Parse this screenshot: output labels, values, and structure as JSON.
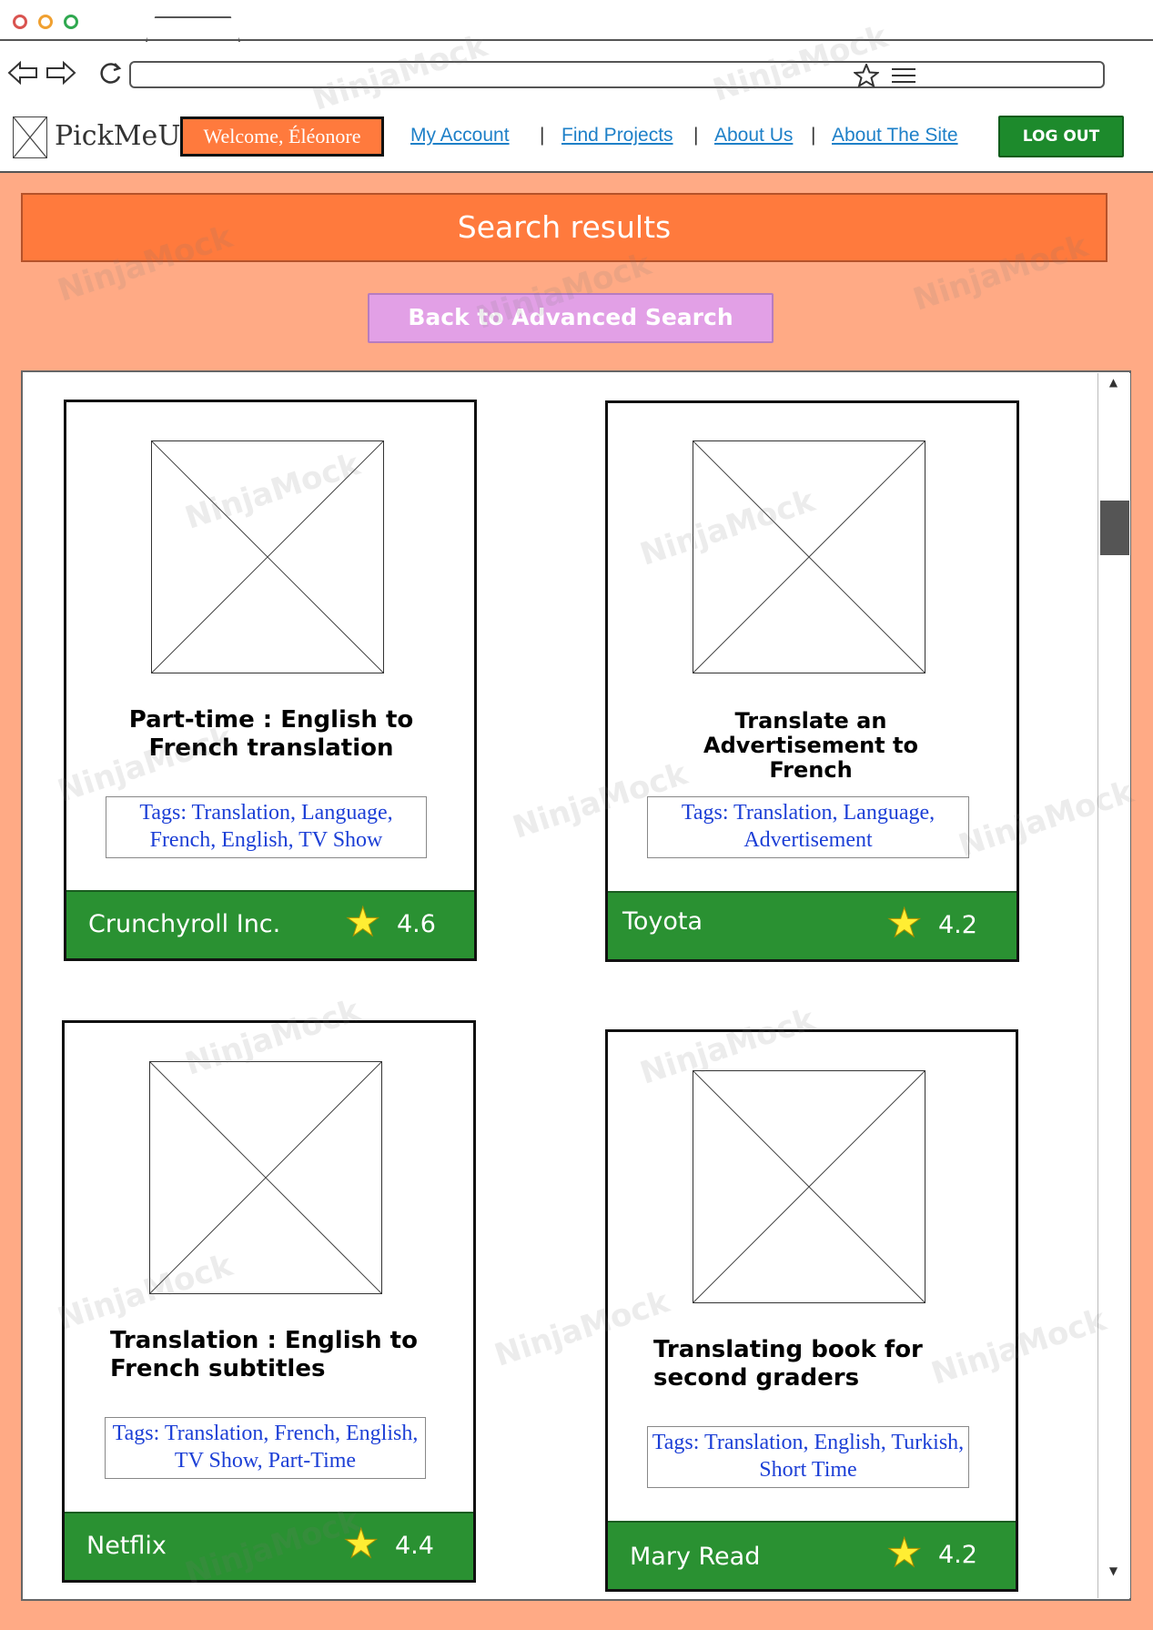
{
  "header": {
    "logo": "PickMeUp",
    "welcome": "Welcome, Éléonore",
    "nav": [
      "My Account",
      "Find Projects",
      "About Us",
      "About The Site"
    ],
    "separator": "|",
    "logout": "LOG OUT"
  },
  "banner": "Search results",
  "back_button": "Back to Advanced Search",
  "cards": [
    {
      "title": "Part-time : English to French translation",
      "tags": "Tags: Translation, Language, French, English, TV Show",
      "company": "Crunchyroll Inc.",
      "rating": "4.6"
    },
    {
      "title": "Translate an Advertisement to French",
      "tags": "Tags: Translation, Language, Advertisement",
      "company": "Toyota",
      "rating": "4.2"
    },
    {
      "title": "Translation : English to French subtitles",
      "tags": "Tags: Translation, French, English, TV Show, Part-Time",
      "company": "Netflix",
      "rating": "4.4"
    },
    {
      "title": "Translating book for second graders",
      "tags": "Tags: Translation, English, Turkish, Short Time",
      "company": "Mary Read",
      "rating": "4.2"
    }
  ],
  "watermark": "NinjaMock",
  "colors": {
    "background": "#ffaa85",
    "banner": "#ff7a3d",
    "footer": "#2a9132",
    "link": "#1e80c8",
    "back_button": "#e2a0e6",
    "logout": "#1d8a2c"
  },
  "icons": {
    "close": "red-circle-icon",
    "minimize": "orange-circle-icon",
    "maximize": "green-circle-icon",
    "back": "arrow-left-icon",
    "forward": "arrow-right-icon",
    "refresh": "refresh-icon",
    "bookmark": "star-outline-icon",
    "menu": "hamburger-icon",
    "rating": "star-icon"
  }
}
